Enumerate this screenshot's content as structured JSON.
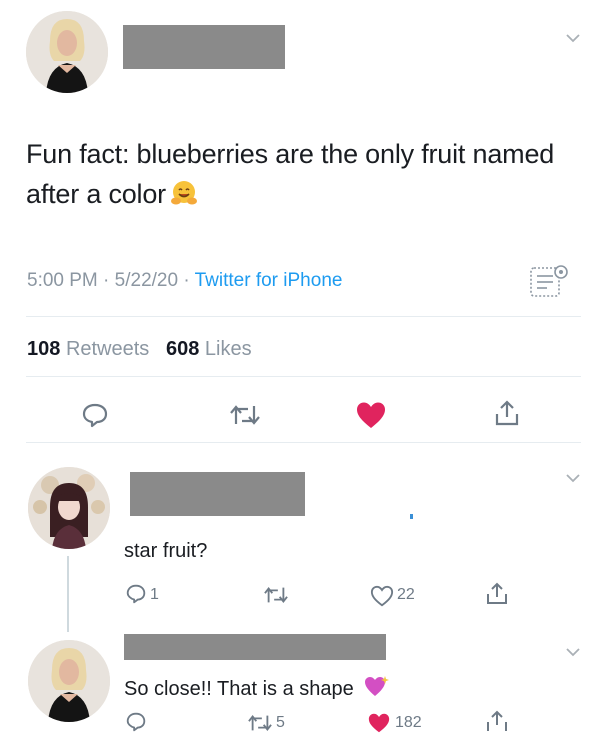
{
  "main_tweet": {
    "text": "Fun fact: blueberries are the only fruit named after a color",
    "emoji": "hugging-face-emoji",
    "time": "5:00 PM",
    "date": "5/22/20",
    "source": "Twitter for iPhone",
    "retweets_count": "108",
    "retweets_label": "Retweets",
    "likes_count": "608",
    "likes_label": "Likes",
    "liked": true
  },
  "replies": [
    {
      "text": "star fruit?",
      "reply_count": "1",
      "retweet_count": "",
      "like_count": "22",
      "liked": false
    },
    {
      "text": "So close!! That is a shape",
      "emoji": "sparkling-heart-emoji",
      "reply_count": "",
      "retweet_count": "5",
      "like_count": "182",
      "liked": true
    }
  ],
  "colors": {
    "like_red": "#e0245e",
    "link_blue": "#1d9bf0",
    "muted_gray": "#8b96a1",
    "redaction_gray": "#8a8a8a"
  }
}
